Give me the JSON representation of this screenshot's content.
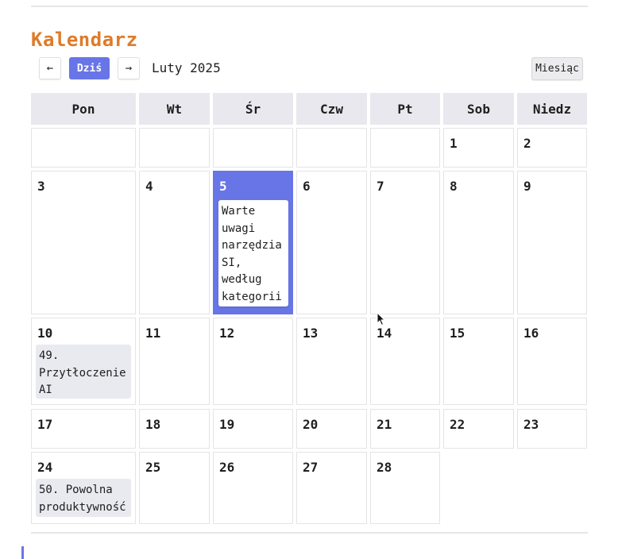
{
  "header": {
    "title": "Kalendarz"
  },
  "toolbar": {
    "prev_icon": "←",
    "today_label": "Dziś",
    "next_icon": "→",
    "period_label": "Luty 2025",
    "view_label": "Miesiąc"
  },
  "weekdays": [
    "Pon",
    "Wt",
    "Śr",
    "Czw",
    "Pt",
    "Sob",
    "Niedz"
  ],
  "days": [
    "1",
    "2",
    "3",
    "4",
    "5",
    "6",
    "7",
    "8",
    "9",
    "10",
    "11",
    "12",
    "13",
    "14",
    "15",
    "16",
    "17",
    "18",
    "19",
    "20",
    "21",
    "22",
    "23",
    "24",
    "25",
    "26",
    "27",
    "28"
  ],
  "selected_day": "5",
  "events": {
    "day5": "Warte\nuwagi\nnarzędzia\nSI,\nwedług\nkategorii",
    "day10": "49.\nPrzytłoczenie\nAI",
    "day24": "50. Powolna\nproduktywność"
  },
  "colors": {
    "title": "#de7b29",
    "accent": "#6875e6",
    "header_bg": "#e8e8ee",
    "event_bg": "#e9e9f0"
  }
}
